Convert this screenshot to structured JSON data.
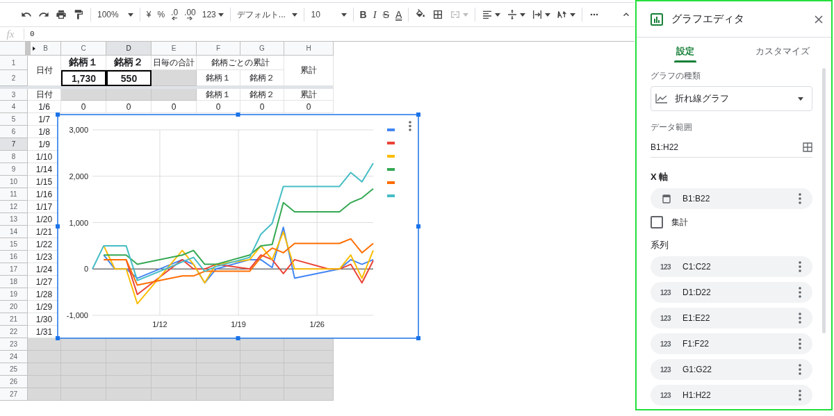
{
  "toolbar": {
    "zoom": "100%",
    "currency": "¥",
    "percent": "%",
    "decrease_decimals": ".0",
    "increase_decimals": ".00",
    "number_format": "123",
    "font": "デフォルト...",
    "font_size": "10",
    "bold": "B",
    "italic": "I",
    "strikethrough": "S",
    "text_color": "A",
    "merge": {
      "disabled": true
    }
  },
  "formula_bar": {
    "fx": "fx",
    "value": "0"
  },
  "sheet": {
    "columns": [
      {
        "label": "B",
        "selected": false
      },
      {
        "label": "C",
        "selected": false
      },
      {
        "label": "D",
        "selected": true
      },
      {
        "label": "E",
        "selected": false
      },
      {
        "label": "F",
        "selected": false
      },
      {
        "label": "G",
        "selected": false
      },
      {
        "label": "H",
        "selected": false
      }
    ],
    "rows": [
      {
        "number": "1",
        "selected": false,
        "cells": [
          {
            "kind": "tall",
            "text": "日付"
          },
          {
            "kind": "plain",
            "text": "銘柄１",
            "bold": true
          },
          {
            "kind": "plain",
            "text": "銘柄２",
            "bold": true
          },
          {
            "kind": "plain",
            "text": "日毎の合計"
          },
          {
            "kind": "wide",
            "text": "銘柄ごとの累計"
          },
          {
            "kind": "covered"
          },
          {
            "kind": "tall",
            "text": "累計"
          }
        ]
      },
      {
        "number": "2",
        "selected": false,
        "cells": [
          {
            "kind": "covered"
          },
          {
            "kind": "plain",
            "text": "1,730",
            "bold": true,
            "boxed": true
          },
          {
            "kind": "plain",
            "text": "550",
            "bold": true,
            "boxed": true
          },
          {
            "kind": "plain",
            "shaded": true
          },
          {
            "kind": "plain",
            "text": "銘柄１"
          },
          {
            "kind": "plain",
            "text": "銘柄２"
          },
          {
            "kind": "covered"
          }
        ]
      },
      {
        "number": "3",
        "selected": false,
        "cells": [
          {
            "kind": "plain",
            "text": "日付"
          },
          {
            "kind": "plain",
            "shaded": true
          },
          {
            "kind": "plain",
            "shaded": true
          },
          {
            "kind": "plain",
            "shaded": true
          },
          {
            "kind": "plain",
            "text": "銘柄１"
          },
          {
            "kind": "plain",
            "text": "銘柄２"
          },
          {
            "kind": "plain",
            "text": "累計"
          }
        ]
      },
      {
        "number": "4",
        "selected": false,
        "cells": [
          {
            "kind": "plain",
            "text": "1/6"
          },
          {
            "kind": "plain",
            "text": "0"
          },
          {
            "kind": "plain",
            "text": "0"
          },
          {
            "kind": "plain",
            "text": "0"
          },
          {
            "kind": "plain",
            "text": "0"
          },
          {
            "kind": "plain",
            "text": "0"
          },
          {
            "kind": "plain",
            "text": "0"
          }
        ]
      },
      {
        "number": "5",
        "selected": false,
        "cells": [
          {
            "kind": "plain",
            "text": "1/7"
          }
        ]
      },
      {
        "number": "6",
        "selected": false,
        "cells": [
          {
            "kind": "plain",
            "text": "1/8"
          }
        ]
      },
      {
        "number": "7",
        "selected": true,
        "cells": [
          {
            "kind": "plain",
            "text": "1/9"
          }
        ]
      },
      {
        "number": "8",
        "selected": false,
        "cells": [
          {
            "kind": "plain",
            "text": "1/10"
          }
        ]
      },
      {
        "number": "9",
        "selected": false,
        "cells": [
          {
            "kind": "plain",
            "text": "1/14"
          }
        ]
      },
      {
        "number": "10",
        "selected": false,
        "cells": [
          {
            "kind": "plain",
            "text": "1/15"
          }
        ]
      },
      {
        "number": "11",
        "selected": false,
        "cells": [
          {
            "kind": "plain",
            "text": "1/16"
          }
        ]
      },
      {
        "number": "12",
        "selected": false,
        "cells": [
          {
            "kind": "plain",
            "text": "1/17"
          }
        ]
      },
      {
        "number": "13",
        "selected": false,
        "cells": [
          {
            "kind": "plain",
            "text": "1/20"
          }
        ]
      },
      {
        "number": "14",
        "selected": false,
        "cells": [
          {
            "kind": "plain",
            "text": "1/21"
          }
        ]
      },
      {
        "number": "15",
        "selected": false,
        "cells": [
          {
            "kind": "plain",
            "text": "1/22"
          }
        ]
      },
      {
        "number": "16",
        "selected": false,
        "cells": [
          {
            "kind": "plain",
            "text": "1/23"
          }
        ]
      },
      {
        "number": "17",
        "selected": false,
        "cells": [
          {
            "kind": "plain",
            "text": "1/24"
          }
        ]
      },
      {
        "number": "18",
        "selected": false,
        "cells": [
          {
            "kind": "plain",
            "text": "1/27"
          }
        ]
      },
      {
        "number": "19",
        "selected": false,
        "cells": [
          {
            "kind": "plain",
            "text": "1/28"
          }
        ]
      },
      {
        "number": "20",
        "selected": false,
        "cells": [
          {
            "kind": "plain",
            "text": "1/29"
          }
        ]
      },
      {
        "number": "21",
        "selected": false,
        "cells": [
          {
            "kind": "plain",
            "text": "1/30"
          }
        ]
      },
      {
        "number": "22",
        "selected": false,
        "cells": [
          {
            "kind": "plain",
            "text": "1/31"
          }
        ]
      },
      {
        "number": "23",
        "selected": false,
        "cells": [
          {
            "kind": "plain",
            "shaded": true
          },
          {
            "kind": "plain",
            "shaded": true
          },
          {
            "kind": "plain",
            "shaded": true
          },
          {
            "kind": "plain",
            "shaded": true
          },
          {
            "kind": "plain",
            "shaded": true
          },
          {
            "kind": "plain",
            "shaded": true
          },
          {
            "kind": "plain",
            "shaded": true
          }
        ]
      },
      {
        "number": "24",
        "selected": false,
        "cells": [
          {
            "kind": "plain",
            "shaded": true
          },
          {
            "kind": "plain",
            "shaded": true
          },
          {
            "kind": "plain",
            "shaded": true
          },
          {
            "kind": "plain",
            "shaded": true
          },
          {
            "kind": "plain",
            "shaded": true
          },
          {
            "kind": "plain",
            "shaded": true
          },
          {
            "kind": "plain",
            "shaded": true
          }
        ]
      },
      {
        "number": "25",
        "selected": false,
        "cells": [
          {
            "kind": "plain",
            "shaded": true
          },
          {
            "kind": "plain",
            "shaded": true
          },
          {
            "kind": "plain",
            "shaded": true
          },
          {
            "kind": "plain",
            "shaded": true
          },
          {
            "kind": "plain",
            "shaded": true
          },
          {
            "kind": "plain",
            "shaded": true
          },
          {
            "kind": "plain",
            "shaded": true
          }
        ]
      },
      {
        "number": "26",
        "selected": false,
        "cells": [
          {
            "kind": "plain",
            "shaded": true
          },
          {
            "kind": "plain",
            "shaded": true
          },
          {
            "kind": "plain",
            "shaded": true
          },
          {
            "kind": "plain",
            "shaded": true
          },
          {
            "kind": "plain",
            "shaded": true
          },
          {
            "kind": "plain",
            "shaded": true
          },
          {
            "kind": "plain",
            "shaded": true
          }
        ]
      },
      {
        "number": "27",
        "selected": false,
        "cells": [
          {
            "kind": "plain",
            "shaded": true
          },
          {
            "kind": "plain",
            "shaded": true
          },
          {
            "kind": "plain",
            "shaded": true
          },
          {
            "kind": "plain",
            "shaded": true
          },
          {
            "kind": "plain",
            "shaded": true
          },
          {
            "kind": "plain",
            "shaded": true
          },
          {
            "kind": "plain",
            "shaded": true
          }
        ]
      }
    ]
  },
  "chart": {
    "chart_data": {
      "type": "line",
      "grid": true,
      "categories": [
        null,
        null,
        null,
        null,
        null,
        null,
        "1/12",
        null,
        null,
        null,
        null,
        null,
        null,
        "1/19",
        null,
        null,
        null,
        null,
        null,
        null,
        "1/26",
        null,
        null,
        null,
        null,
        null
      ],
      "ylim": [
        -1000,
        3000
      ],
      "yticks": [
        {
          "value": -1000,
          "label": "-1,000"
        },
        {
          "value": 0,
          "label": "0"
        },
        {
          "value": 1000,
          "label": "1,000"
        },
        {
          "value": 2000,
          "label": "2,000"
        },
        {
          "value": 3000,
          "label": "3,000"
        }
      ],
      "series": [
        {
          "color": "#4285f4",
          "values": [
            null,
            300,
            0,
            0,
            -200,
            null,
            null,
            null,
            200,
            100,
            -300,
            0,
            null,
            null,
            200,
            200,
            30,
            900,
            -200,
            null,
            null,
            null,
            0,
            200,
            100,
            200
          ]
        },
        {
          "color": "#ea4335",
          "values": [
            null,
            null,
            null,
            200,
            -550,
            null,
            null,
            null,
            200,
            0,
            0,
            100,
            null,
            null,
            0,
            300,
            200,
            -100,
            200,
            null,
            null,
            0,
            0,
            100,
            -300,
            180
          ]
        },
        {
          "color": "#fbbc04",
          "values": [
            null,
            500,
            0,
            0,
            -750,
            null,
            null,
            null,
            400,
            100,
            -300,
            100,
            null,
            null,
            200,
            500,
            200,
            800,
            0,
            null,
            null,
            0,
            0,
            300,
            -200,
            400
          ]
        },
        {
          "color": "#34a853",
          "values": [
            null,
            300,
            300,
            300,
            100,
            null,
            null,
            null,
            300,
            400,
            100,
            100,
            null,
            null,
            300,
            500,
            530,
            1430,
            1230,
            null,
            null,
            1230,
            1230,
            1430,
            1530,
            1730
          ]
        },
        {
          "color": "#ff6d01",
          "values": [
            null,
            200,
            200,
            200,
            -350,
            null,
            null,
            null,
            -150,
            -150,
            -50,
            -50,
            null,
            null,
            -50,
            250,
            450,
            350,
            550,
            null,
            null,
            550,
            550,
            650,
            350,
            550
          ]
        },
        {
          "color": "#46bdc6",
          "values": [
            0,
            500,
            500,
            500,
            -250,
            null,
            null,
            null,
            150,
            250,
            -50,
            50,
            null,
            null,
            250,
            750,
            980,
            1780,
            1780,
            null,
            null,
            1780,
            1780,
            2080,
            1880,
            2280
          ]
        }
      ]
    }
  },
  "chart_editor": {
    "title": "グラフエディタ",
    "tabs": [
      {
        "label": "設定",
        "selected": true
      },
      {
        "label": "カスタマイズ",
        "selected": false
      }
    ],
    "chart_type": {
      "label": "グラフの種類",
      "value": "折れ線グラフ"
    },
    "data_range": {
      "label": "データ範囲",
      "value": "B1:H22"
    },
    "x_axis": {
      "label": "X 軸",
      "range": "B1:B22"
    },
    "aggregate": {
      "label": "集計",
      "checked": false
    },
    "series": {
      "label": "系列",
      "items": [
        {
          "type": "123",
          "range": "C1:C22"
        },
        {
          "type": "123",
          "range": "D1:D22"
        },
        {
          "type": "123",
          "range": "E1:E22"
        },
        {
          "type": "123",
          "range": "F1:F22"
        },
        {
          "type": "123",
          "range": "G1:G22"
        },
        {
          "type": "123",
          "range": "H1:H22"
        }
      ]
    }
  }
}
